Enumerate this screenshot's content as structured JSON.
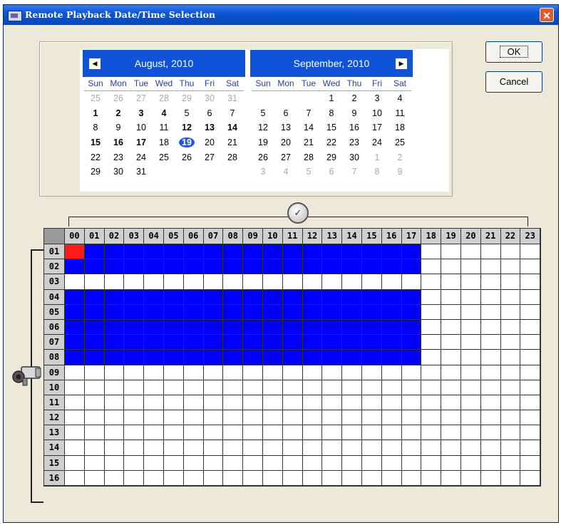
{
  "window": {
    "title": "Remote Playback Date/Time Selection",
    "close_glyph": "✕"
  },
  "buttons": {
    "ok": "OK",
    "cancel": "Cancel"
  },
  "calendar": {
    "weekdays": [
      "Sun",
      "Mon",
      "Tue",
      "Wed",
      "Thu",
      "Fri",
      "Sat"
    ],
    "nav_prev": "◀",
    "nav_next": "▶",
    "months": [
      {
        "title": "August, 2010",
        "days": [
          {
            "d": "25",
            "other": true
          },
          {
            "d": "26",
            "other": true
          },
          {
            "d": "27",
            "other": true
          },
          {
            "d": "28",
            "other": true
          },
          {
            "d": "29",
            "other": true
          },
          {
            "d": "30",
            "other": true
          },
          {
            "d": "31",
            "other": true
          },
          {
            "d": "1",
            "bold": true
          },
          {
            "d": "2",
            "bold": true
          },
          {
            "d": "3",
            "bold": true
          },
          {
            "d": "4",
            "bold": true
          },
          {
            "d": "5"
          },
          {
            "d": "6"
          },
          {
            "d": "7"
          },
          {
            "d": "8"
          },
          {
            "d": "9"
          },
          {
            "d": "10"
          },
          {
            "d": "11"
          },
          {
            "d": "12",
            "bold": true
          },
          {
            "d": "13",
            "bold": true
          },
          {
            "d": "14",
            "bold": true
          },
          {
            "d": "15",
            "bold": true
          },
          {
            "d": "16",
            "bold": true
          },
          {
            "d": "17",
            "bold": true
          },
          {
            "d": "18"
          },
          {
            "d": "19",
            "today": true
          },
          {
            "d": "20"
          },
          {
            "d": "21"
          },
          {
            "d": "22"
          },
          {
            "d": "23"
          },
          {
            "d": "24"
          },
          {
            "d": "25"
          },
          {
            "d": "26"
          },
          {
            "d": "27"
          },
          {
            "d": "28"
          },
          {
            "d": "29"
          },
          {
            "d": "30"
          },
          {
            "d": "31"
          }
        ]
      },
      {
        "title": "September, 2010",
        "days": [
          {
            "d": ""
          },
          {
            "d": ""
          },
          {
            "d": ""
          },
          {
            "d": "1"
          },
          {
            "d": "2"
          },
          {
            "d": "3"
          },
          {
            "d": "4"
          },
          {
            "d": "5"
          },
          {
            "d": "6"
          },
          {
            "d": "7"
          },
          {
            "d": "8"
          },
          {
            "d": "9"
          },
          {
            "d": "10"
          },
          {
            "d": "11"
          },
          {
            "d": "12"
          },
          {
            "d": "13"
          },
          {
            "d": "14"
          },
          {
            "d": "15"
          },
          {
            "d": "16"
          },
          {
            "d": "17"
          },
          {
            "d": "18"
          },
          {
            "d": "19"
          },
          {
            "d": "20"
          },
          {
            "d": "21"
          },
          {
            "d": "22"
          },
          {
            "d": "23"
          },
          {
            "d": "24"
          },
          {
            "d": "25"
          },
          {
            "d": "26"
          },
          {
            "d": "27"
          },
          {
            "d": "28"
          },
          {
            "d": "29"
          },
          {
            "d": "30"
          },
          {
            "d": "1",
            "other": true
          },
          {
            "d": "2",
            "other": true
          },
          {
            "d": "3",
            "other": true
          },
          {
            "d": "4",
            "other": true
          },
          {
            "d": "5",
            "other": true
          },
          {
            "d": "6",
            "other": true
          },
          {
            "d": "7",
            "other": true
          },
          {
            "d": "8",
            "other": true
          },
          {
            "d": "9",
            "other": true
          }
        ]
      }
    ]
  },
  "timeline": {
    "hours": [
      "00",
      "01",
      "02",
      "03",
      "04",
      "05",
      "06",
      "07",
      "08",
      "09",
      "10",
      "11",
      "12",
      "13",
      "14",
      "15",
      "16",
      "17",
      "18",
      "19",
      "20",
      "21",
      "22",
      "23"
    ],
    "channels": [
      "01",
      "02",
      "03",
      "04",
      "05",
      "06",
      "07",
      "08",
      "09",
      "10",
      "11",
      "12",
      "13",
      "14",
      "15",
      "16"
    ],
    "recorded_channels": [
      "01",
      "02",
      "04",
      "05",
      "06",
      "07",
      "08"
    ],
    "recorded_hours_through": "17",
    "selected": {
      "channel": "01",
      "hour": "00"
    }
  },
  "icons": {
    "clock": "clock-icon",
    "camera": "camera-icon"
  },
  "colors": {
    "recorded": "#0000ff",
    "selected": "#ff1a1a",
    "titlebar": "#0a57d6",
    "calendar_header": "#1153d8"
  }
}
